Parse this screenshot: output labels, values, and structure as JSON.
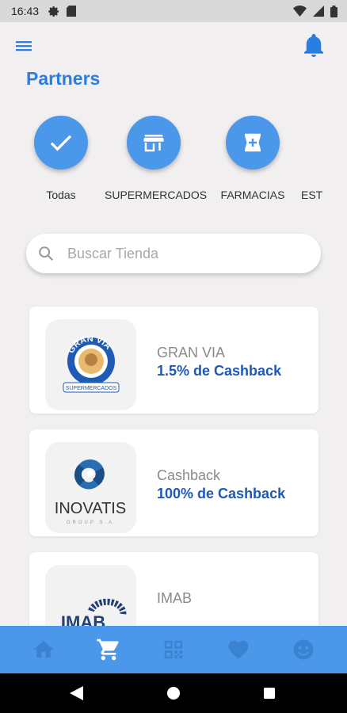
{
  "status_bar": {
    "time": "16:43"
  },
  "header": {
    "title": "Partners"
  },
  "categories": [
    {
      "label": "Todas",
      "icon": "check-icon"
    },
    {
      "label": "SUPERMERCADOS",
      "icon": "store-icon"
    },
    {
      "label": "FARMACIAS",
      "icon": "pharmacy-icon"
    },
    {
      "label": "EST",
      "icon": ""
    }
  ],
  "search": {
    "placeholder": "Buscar Tienda",
    "value": ""
  },
  "stores": [
    {
      "name": "GRAN VIA",
      "cashback": "1.5% de Cashback",
      "logo_ring_text": "GRAN VIA",
      "logo_caption": "SUPERMERCADOS"
    },
    {
      "name": "Cashback",
      "cashback": "100% de Cashback",
      "logo_text": "INOVATIS",
      "logo_caption": "GROUP S.A"
    },
    {
      "name": "IMAB",
      "cashback": "",
      "logo_text": "IMAB"
    }
  ],
  "bottom_nav": [
    {
      "name": "home-icon",
      "active": false
    },
    {
      "name": "cart-icon",
      "active": true
    },
    {
      "name": "qr-code-icon",
      "active": false
    },
    {
      "name": "heart-icon",
      "active": false
    },
    {
      "name": "profile-icon",
      "active": false
    }
  ],
  "colors": {
    "accent": "#2a7de1",
    "category_circle": "#4b97ea",
    "cashback_text": "#1f58b8",
    "bottom_nav_bg": "#4b97ea",
    "nav_icon_active": "#ffffff",
    "nav_icon_inactive": "#3b82d0",
    "background": "#f1efef"
  }
}
